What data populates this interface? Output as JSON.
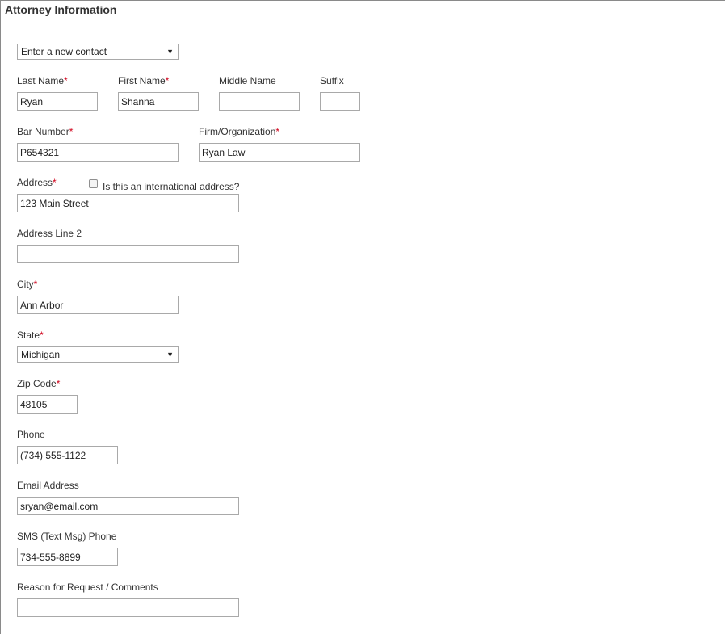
{
  "section": {
    "title": "Attorney Information"
  },
  "contact_select": {
    "value": "Enter a new contact"
  },
  "required_marker": "*",
  "dropdown_arrow_icon": "triangle-down",
  "fields": {
    "last_name": {
      "label": "Last Name",
      "value": "Ryan"
    },
    "first_name": {
      "label": "First Name",
      "value": "Shanna"
    },
    "middle_name": {
      "label": "Middle Name",
      "value": ""
    },
    "suffix": {
      "label": "Suffix",
      "value": ""
    },
    "bar_number": {
      "label": "Bar Number",
      "value": "P654321"
    },
    "firm": {
      "label": "Firm/Organization",
      "value": "Ryan Law"
    },
    "address": {
      "label": "Address",
      "value": "123 Main Street"
    },
    "international": {
      "label": "Is this an international address?",
      "checked": false
    },
    "address2": {
      "label": "Address Line 2",
      "value": ""
    },
    "city": {
      "label": "City",
      "value": "Ann Arbor"
    },
    "state": {
      "label": "State",
      "value": "Michigan"
    },
    "zip": {
      "label": "Zip Code",
      "value": "48105"
    },
    "phone": {
      "label": "Phone",
      "value": "(734) 555-1122"
    },
    "email": {
      "label": "Email Address",
      "value": "sryan@email.com"
    },
    "sms_phone": {
      "label": "SMS (Text Msg) Phone",
      "value": "734-555-8899"
    },
    "reason": {
      "label": "Reason for Request / Comments",
      "value": ""
    }
  }
}
